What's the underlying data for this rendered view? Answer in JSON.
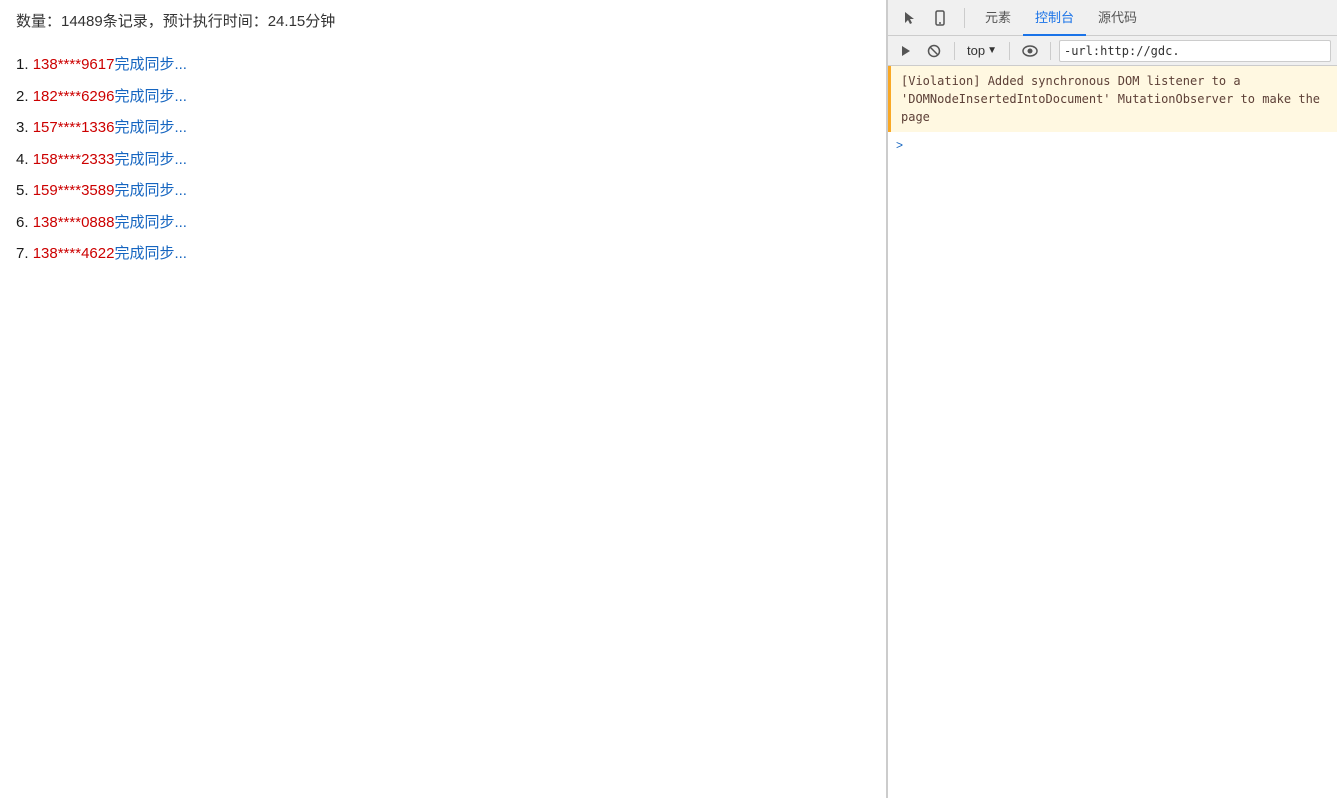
{
  "left": {
    "status": {
      "label": "数量：14489条记录，预计执行时间：24.15分钟"
    },
    "items": [
      {
        "num": "1.",
        "account": "138****9617",
        "suffix": "完成同步..."
      },
      {
        "num": "2.",
        "account": "182****6296",
        "suffix": "完成同步..."
      },
      {
        "num": "3.",
        "account": "157****1336",
        "suffix": "完成同步..."
      },
      {
        "num": "4.",
        "account": "158****2333",
        "suffix": "完成同步..."
      },
      {
        "num": "5.",
        "account": "159****3589",
        "suffix": "完成同步..."
      },
      {
        "num": "6.",
        "account": "138****0888",
        "suffix": "完成同步..."
      },
      {
        "num": "7.",
        "account": "138****4622",
        "suffix": "完成同步..."
      }
    ]
  },
  "devtools": {
    "tabs": [
      {
        "label": "元素",
        "active": false
      },
      {
        "label": "控制台",
        "active": true
      },
      {
        "label": "源代码",
        "active": false
      }
    ],
    "toolbar": {
      "top_label": "top",
      "url_value": "-url:http://gdc."
    },
    "violation": {
      "text": "[Violation] Added synchronous DOM listener to a 'DOMNodeInsertedIntoDocument' MutationObserver to make the page"
    },
    "prompt_symbol": ">"
  }
}
